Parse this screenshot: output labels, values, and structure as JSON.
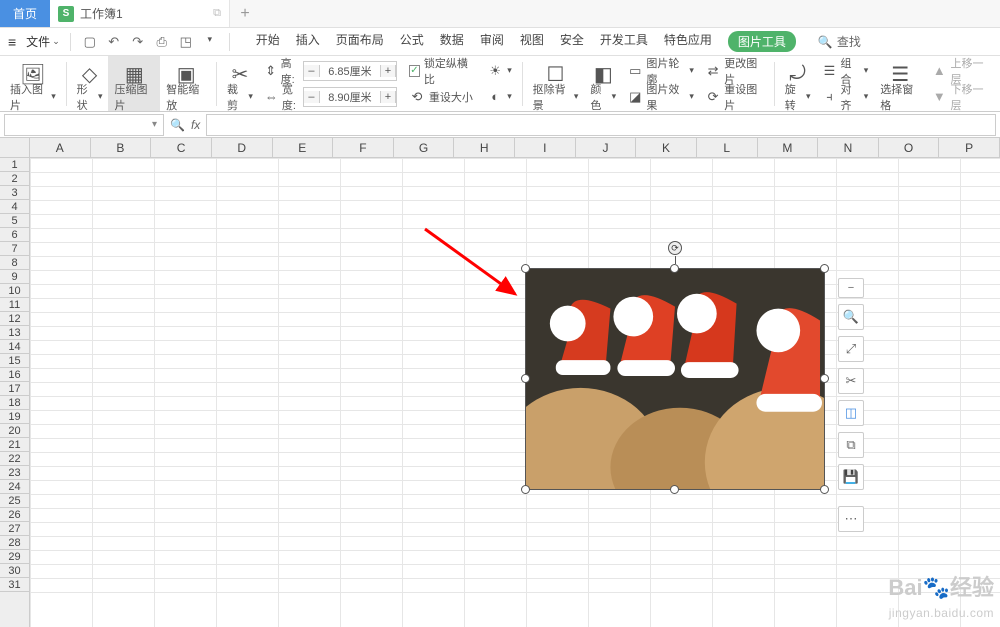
{
  "tabs": {
    "home": "首页",
    "doc_icon": "S",
    "doc_name": "工作簿1",
    "new": "+",
    "mini": "⧉"
  },
  "menu": {
    "file": "文件",
    "arrow": "⌄",
    "tabs": [
      "开始",
      "插入",
      "页面布局",
      "公式",
      "数据",
      "审阅",
      "视图",
      "安全",
      "开发工具",
      "特色应用"
    ],
    "active_tab": "图片工具",
    "search": "查找"
  },
  "ribbon": {
    "insert_image": "插入图片",
    "shape": "形状",
    "compress": "压缩图片",
    "smart_zoom": "智能缩放",
    "crop": "裁剪",
    "height_label": "高度:",
    "height_val": "6.85厘米",
    "width_label": "宽度:",
    "width_val": "8.90厘米",
    "lock_ratio": "锁定纵横比",
    "reset_size": "重设大小",
    "remove_bg": "抠除背景",
    "color": "颜色",
    "outline": "图片轮廓",
    "effects": "图片效果",
    "change_pic": "更改图片",
    "reset_pic": "重设图片",
    "rotate": "旋转",
    "group": "组合",
    "align": "对齐",
    "select_pane": "选择窗格",
    "move_up": "上移一层",
    "move_down": "下移一层"
  },
  "grid": {
    "cols": [
      "A",
      "B",
      "C",
      "D",
      "E",
      "F",
      "G",
      "H",
      "I",
      "J",
      "K",
      "L",
      "M",
      "N",
      "O",
      "P"
    ],
    "rows_count": 31
  },
  "watermark": {
    "brand": "Bai",
    "brand2": "经验",
    "sub": "jingyan.baidu.com"
  }
}
